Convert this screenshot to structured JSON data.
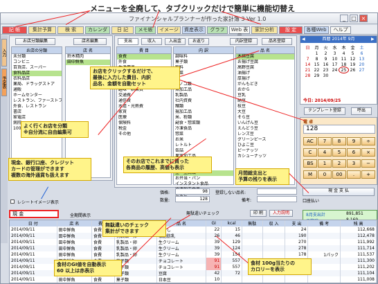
{
  "banner": {
    "text": "メニューを全廃して、タブクリックだけで簡単に機能切替え"
  },
  "window": {
    "title": "ファイナンシャルプランナーが作った家計簿 3  Ver 1.0",
    "minimize": "_",
    "maximize": "□",
    "close": "×"
  },
  "menu": [
    "記 帳",
    "集計予算",
    "検 索",
    "カレンダー",
    "日 記",
    "メモ帳",
    "イメージ",
    "資産表示",
    "グラフ",
    "Web 表示",
    "家計分析",
    "設 定",
    "各種Web",
    "ヘルプ"
  ],
  "side_tabs": [
    "入力",
    "予定表"
  ],
  "shops": {
    "panel_btn": "お店分類編集",
    "list_btn": "店名編集",
    "col_cat": "お店の分類",
    "col_name": "店 名",
    "categories": [
      "未分類",
      "コンビニ",
      "百貨店、スーパー",
      "食料品店",
      "衣料品店",
      "薬局、ドラッグストア",
      "通販",
      "ホームセンター",
      "レストラン、ファーストフード",
      "外食、レストラン",
      "書店",
      "家電店",
      "病院",
      "100円ショップ"
    ],
    "names": [
      "鈴木精肉",
      "田中鮮魚"
    ]
  },
  "items": {
    "tabs": [
      "支出",
      "収入",
      "入出金",
      "お返り"
    ],
    "btn_left": "内訳登録",
    "btn_right": "品名登録",
    "col1": "費 目",
    "col2": "内 訳",
    "col3": "品 名",
    "cats": [
      "食費",
      "外食",
      "生活用品",
      "衣類",
      "教育・子供費",
      "交際費",
      "趣味・娯楽費",
      "交通費",
      "通信費",
      "水道・光熱費",
      "家賃",
      "医療",
      "保険料",
      "税金",
      "その他"
    ],
    "subs": [
      "調味料",
      "菓子類",
      "飲料",
      "野菜",
      "肉",
      "キノコ類",
      "魚加工品",
      "乳製品",
      "社内資費",
      "麺類",
      "揚加工品",
      "米、粉類",
      "副食・惣菜類",
      "冷凍食品",
      "惣菜",
      "お米",
      "レトルト",
      "缶詰",
      "果実加工品",
      "外食",
      "揚加工食品",
      "豆・豆腐類",
      "お弁当・パン",
      "インスタント食品",
      "冷凍加工食品",
      "たまご"
    ],
    "products": [
      "木綿豆腐",
      "お揚げ豆腐",
      "高野豆腐",
      "油揚げ",
      "厚揚げ",
      "がんもどき",
      "おから",
      "豆乳",
      "納豆",
      "枝豆",
      "大豆",
      "そら豆",
      "いんげん豆",
      "えんどう豆",
      "レンズ豆",
      "グリーンピース",
      "ひよこ豆",
      "ピーナッツ",
      "カシューナッツ"
    ]
  },
  "form": {
    "price_label": "価格:",
    "price_value": "98",
    "qty_label": "数量:",
    "qty_value": "128",
    "product_label": "登録しない品名:",
    "note_label": "備考:",
    "expense_input_label": "出 費 計上",
    "memo_label": "残高調整"
  },
  "calendar": {
    "title": "西暦 2014年 9月",
    "prev": "◀",
    "next": "▶",
    "days": [
      "日",
      "月",
      "火",
      "水",
      "木",
      "金",
      "土"
    ],
    "weeks": [
      [
        "",
        "1",
        "2",
        "3",
        "4",
        "5",
        "6"
      ],
      [
        "7",
        "8",
        "9",
        "10",
        "11",
        "12",
        "13"
      ],
      [
        "14",
        "15",
        "16",
        "17",
        "18",
        "19",
        "20"
      ],
      [
        "21",
        "22",
        "23",
        "24",
        "25",
        "26",
        "27"
      ],
      [
        "28",
        "29",
        "30",
        "",
        "",
        "",
        ""
      ]
    ],
    "today": "今日: 2014/09/25"
  },
  "template": {
    "btn": "テンプレート登録",
    "recall": "呼出"
  },
  "calc": {
    "title": "電 卓",
    "display": "128",
    "keys": [
      [
        "AC",
        "7",
        "8",
        "9",
        "÷"
      ],
      [
        "C",
        "4",
        "5",
        "6",
        "×"
      ],
      [
        "BS",
        "1",
        "2",
        "3",
        "−"
      ],
      [
        "M",
        "0",
        "00",
        ".",
        "+"
      ]
    ]
  },
  "cash": {
    "label": "現 金 支 払",
    "acct": "口座払い"
  },
  "receipt": {
    "label": "レシートイメージ表示"
  },
  "account": {
    "label": "現 金",
    "all": "全期間表示"
  },
  "table_btns": {
    "print": "印 刷",
    "input": "入力説明"
  },
  "lunch_check": "無駄遣いチェック",
  "summary": {
    "label1": "8月支出計",
    "value1": "891,851",
    "label2": "予算残",
    "value2": "8,169"
  },
  "table": {
    "headers": [
      "日 付",
      "店 名",
      "費 目",
      "内 訳",
      "品 名",
      "GI",
      "kcal",
      "無駄",
      "収 入",
      "支 出",
      "備 考",
      "残 高"
    ],
    "rows": [
      [
        "2014/09/11",
        "田中鮮魚",
        "食費",
        "野菜類",
        "もやし",
        "22",
        "15",
        "",
        "",
        "24",
        "",
        "112,668"
      ],
      [
        "2014/09/11",
        "田中鮮魚",
        "食費",
        "乳製品・卵",
        "低脂肪乳",
        "26",
        "46",
        "",
        "",
        "190",
        "",
        "112,478"
      ],
      [
        "2014/09/11",
        "田中鮮魚",
        "食費",
        "乳製品・卵",
        "生クリーム",
        "39",
        "129",
        "",
        "",
        "270",
        "",
        "111,992"
      ],
      [
        "2014/09/11",
        "田中鮮魚",
        "食費",
        "乳製品・卵",
        "生クリーム",
        "39",
        "124",
        "",
        "",
        "278",
        "",
        "111,714"
      ],
      [
        "2014/09/11",
        "田中鮮魚",
        "食費",
        "乳製品・卵",
        "生クリーム",
        "39",
        "154",
        "",
        "",
        "178",
        "1パック",
        "111,537"
      ],
      [
        "2014/09/11",
        "田中鮮魚",
        "食費",
        "菓子類",
        "チョコレート",
        "91",
        "557",
        "●",
        "",
        "238",
        "",
        "111,300"
      ],
      [
        "2014/09/11",
        "田中鮮魚",
        "食費",
        "菓子類",
        "チョコレート",
        "91",
        "557",
        "●",
        "",
        "98",
        "",
        "111,202"
      ],
      [
        "2014/09/11",
        "田中鮮魚",
        "食費",
        "菓子類",
        "豆腐",
        "42",
        "72",
        "",
        "",
        "98",
        "",
        "111,104"
      ],
      [
        "2014/09/11",
        "田中鮮魚",
        "食費",
        "菓子類",
        "日本豆",
        "10",
        "",
        "",
        "",
        "",
        "",
        "111,008"
      ]
    ]
  },
  "callouts": {
    "shop_classify": "よく行くお店を分類\n※自分流に自由編集可",
    "click_shop": "お店をクリックするだけで、\n最後に入力した費目、内訳\n品名、金額を自動セット",
    "history": "そのお店でこれまでに買った\n各商品の履歴、高値も表示",
    "money": "現金、銀行口座、クレジット\nカードの管理ができます\n複数の海外通貨も扱えます",
    "monthly": "月間総支出と\n予算の残りを表示",
    "waste": "無駄遣いのチェック\n集計ができます",
    "gi": "食材のGI値を自動表示\n60 以上は赤表示",
    "calorie": "食材 100g当たりの\nカロリーを表示"
  }
}
